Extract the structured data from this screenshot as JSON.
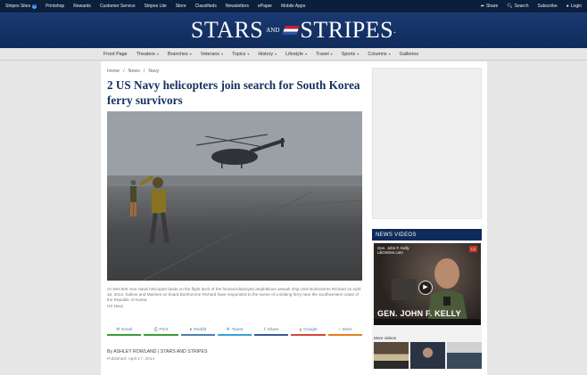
{
  "topbar": {
    "left": [
      "Stripes Sites",
      "Printshop",
      "Rewards",
      "Customer Service",
      "Stripes Lite",
      "Store",
      "Classifieds",
      "Newsletters",
      "ePaper",
      "Mobile Apps"
    ],
    "right": {
      "share": "Share",
      "search": "Search",
      "subscribe": "Subscribe",
      "login": "Login"
    }
  },
  "brand": {
    "left": "STARS",
    "and": "AND",
    "right": "STRIPES",
    "mark": "."
  },
  "nav": [
    {
      "label": "Front Page",
      "dropdown": false
    },
    {
      "label": "Theaters",
      "dropdown": true
    },
    {
      "label": "Branches",
      "dropdown": true
    },
    {
      "label": "Veterans",
      "dropdown": true
    },
    {
      "label": "Topics",
      "dropdown": true
    },
    {
      "label": "History",
      "dropdown": true
    },
    {
      "label": "Lifestyle",
      "dropdown": true
    },
    {
      "label": "Travel",
      "dropdown": true
    },
    {
      "label": "Sports",
      "dropdown": true
    },
    {
      "label": "Columns",
      "dropdown": true
    },
    {
      "label": "Galleries",
      "dropdown": false
    }
  ],
  "breadcrumb": [
    "Home",
    "News",
    "Navy"
  ],
  "article": {
    "headline": "2 US Navy helicopters join search for South Korea ferry survivors",
    "caption": "An MH-60S Sea Hawk helicopter lands on the flight deck of the forward-deployed amphibious assault ship USS Bonhomme Richard on April 16, 2014. Sailors and Marines on board Bonhomme Richard have responded to the scene of a sinking ferry near the southwestern coast of the Republic of Korea.",
    "credit": "US Navy",
    "byline": "By ASHLEY ROWLAND | STARS AND STRIPES",
    "published": "Published: April 17, 2014"
  },
  "share_buttons": [
    {
      "label": "Email",
      "icon": "envelope-icon",
      "color": "#3a9a3a"
    },
    {
      "label": "Print",
      "icon": "printer-icon",
      "color": "#3a9a3a"
    },
    {
      "label": "Reddit",
      "icon": "reddit-icon",
      "color": "#4a7fb0"
    },
    {
      "label": "Tweet",
      "icon": "twitter-icon",
      "color": "#3aa0d8"
    },
    {
      "label": "Share",
      "icon": "facebook-icon",
      "color": "#3b5998"
    },
    {
      "label": "Google",
      "icon": "google-icon",
      "color": "#d34836"
    },
    {
      "label": "More",
      "icon": "plus-icon",
      "color": "#e67e22"
    }
  ],
  "news_videos": {
    "title": "NEWS VIDEOS",
    "video_title": "Gen. John F. Kelly",
    "video_source": "LiliOnDen.com",
    "badge": "LZ",
    "lower_third": "GEN. JOHN F. KELLY",
    "more_label": "More videos"
  },
  "colors": {
    "masthead": "#0f2b5a",
    "topbar": "#0b1f3c",
    "headline": "#13305e"
  }
}
